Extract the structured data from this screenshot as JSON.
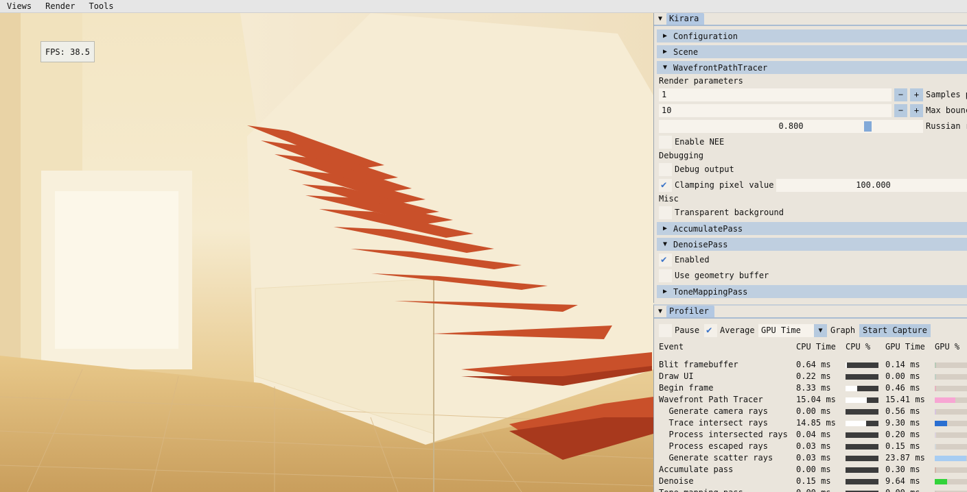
{
  "menu": [
    "Views",
    "Render",
    "Tools"
  ],
  "viewport": {
    "fps": "FPS: 38.5"
  },
  "kirara": {
    "title": "Kirara",
    "sections": {
      "configuration": "Configuration",
      "scene": "Scene",
      "wavefront": "WavefrontPathTracer",
      "accumulate": "AccumulatePass",
      "denoise": "DenoisePass",
      "tonemapping": "ToneMappingPass"
    },
    "render_parameters": "Render parameters",
    "samples": {
      "value": "1",
      "label": "Samples p"
    },
    "max_bounce": {
      "value": "10",
      "label": "Max bounc"
    },
    "russian": {
      "value": "0.800",
      "fraction": 0.8,
      "label": "Russian r"
    },
    "enable_nee": {
      "label": "Enable NEE",
      "checked": false
    },
    "debugging": "Debugging",
    "debug_output": {
      "label": "Debug output",
      "checked": false
    },
    "clamping": {
      "label": "Clamping pixel value",
      "checked": true,
      "value": "100.000"
    },
    "misc": "Misc",
    "transparent_bg": {
      "label": "Transparent background",
      "checked": false
    },
    "denoise_enabled": {
      "label": "Enabled",
      "checked": true
    },
    "use_geometry": {
      "label": "Use geometry buffer",
      "checked": false
    },
    "minus": "−",
    "plus": "+"
  },
  "profiler": {
    "title": "Profiler",
    "pause": "Pause",
    "average": "Average",
    "mode": "GPU Time",
    "graph": "Graph",
    "start_capture": "Start Capture",
    "headers": [
      "Event",
      "CPU Time",
      "CPU %",
      "GPU Time",
      "GPU %"
    ],
    "rows": [
      {
        "event": "Blit framebuffer",
        "cpu": "0.64 ms",
        "cpu_pct": 0.04,
        "gpu": "0.14 ms",
        "gpu_pct": 0.01,
        "color": "#b7c9b7"
      },
      {
        "event": "Draw UI",
        "cpu": "0.22 ms",
        "cpu_pct": 0.01,
        "gpu": "0.00 ms",
        "gpu_pct": 0.0,
        "color": "#bfcfc3"
      },
      {
        "event": "Begin frame",
        "cpu": "8.33 ms",
        "cpu_pct": 0.35,
        "gpu": "0.46 ms",
        "gpu_pct": 0.02,
        "color": "#e5b3bf"
      },
      {
        "event": "Wavefront Path Tracer",
        "cpu": "15.04 ms",
        "cpu_pct": 0.65,
        "gpu": "15.41 ms",
        "gpu_pct": 0.62,
        "color": "#f7a6d3"
      },
      {
        "event": "  Generate camera rays",
        "cpu": "0.00 ms",
        "cpu_pct": 0.0,
        "gpu": "0.56 ms",
        "gpu_pct": 0.03,
        "color": "#d8c4df"
      },
      {
        "event": "  Trace intersect rays",
        "cpu": "14.85 ms",
        "cpu_pct": 0.62,
        "gpu": "9.30 ms",
        "gpu_pct": 0.38,
        "color": "#2a6fd1"
      },
      {
        "event": "  Process intersected rays",
        "cpu": "0.04 ms",
        "cpu_pct": 0.0,
        "gpu": "0.20 ms",
        "gpu_pct": 0.01,
        "color": "#dcd3dc"
      },
      {
        "event": "  Process escaped rays",
        "cpu": "0.03 ms",
        "cpu_pct": 0.0,
        "gpu": "0.15 ms",
        "gpu_pct": 0.01,
        "color": "#d3d7d9"
      },
      {
        "event": "  Generate scatter rays",
        "cpu": "0.03 ms",
        "cpu_pct": 0.0,
        "gpu": "23.87 ms",
        "gpu_pct": 0.96,
        "color": "#a8cdf2"
      },
      {
        "event": "Accumulate pass",
        "cpu": "0.00 ms",
        "cpu_pct": 0.0,
        "gpu": "0.30 ms",
        "gpu_pct": 0.01,
        "color": "#d4b4aa"
      },
      {
        "event": "Denoise",
        "cpu": "0.15 ms",
        "cpu_pct": 0.0,
        "gpu": "9.64 ms",
        "gpu_pct": 0.38,
        "color": "#33d33b"
      },
      {
        "event": "Tone mapping pass",
        "cpu": "0.00 ms",
        "cpu_pct": 0.0,
        "gpu": "0.00 ms",
        "gpu_pct": 0.0,
        "color": "#cfc7c0"
      }
    ]
  },
  "colors": {
    "header_bg": "#bfcfe0",
    "button_bg": "#b6cadf",
    "accent": "#3a73c8",
    "panel_bg": "#eae5dc"
  }
}
